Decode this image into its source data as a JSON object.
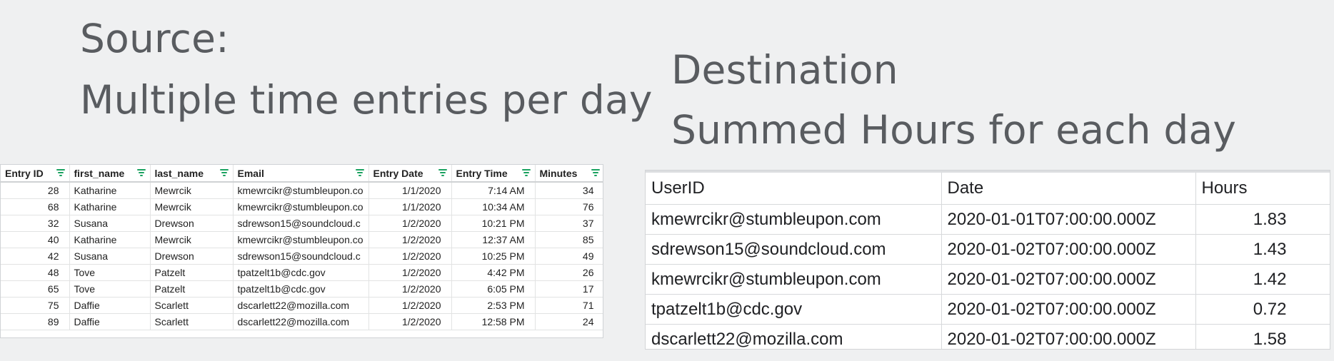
{
  "source": {
    "title": "Source:",
    "subtitle": "Multiple time entries per day",
    "columns": [
      "Entry ID",
      "first_name",
      "last_name",
      "Email",
      "Entry Date",
      "Entry Time",
      "Minutes"
    ],
    "filter_icon": "filter-icon",
    "filter_color": "#1aa260",
    "rows": [
      [
        "28",
        "Katharine",
        "Mewrcik",
        "kmewrcikr@stumbleupon.co",
        "1/1/2020",
        "7:14 AM",
        "34"
      ],
      [
        "68",
        "Katharine",
        "Mewrcik",
        "kmewrcikr@stumbleupon.co",
        "1/1/2020",
        "10:34 AM",
        "76"
      ],
      [
        "32",
        "Susana",
        "Drewson",
        "sdrewson15@soundcloud.c",
        "1/2/2020",
        "10:21 PM",
        "37"
      ],
      [
        "40",
        "Katharine",
        "Mewrcik",
        "kmewrcikr@stumbleupon.co",
        "1/2/2020",
        "12:37 AM",
        "85"
      ],
      [
        "42",
        "Susana",
        "Drewson",
        "sdrewson15@soundcloud.c",
        "1/2/2020",
        "10:25 PM",
        "49"
      ],
      [
        "48",
        "Tove",
        "Patzelt",
        "tpatzelt1b@cdc.gov",
        "1/2/2020",
        "4:42 PM",
        "26"
      ],
      [
        "65",
        "Tove",
        "Patzelt",
        "tpatzelt1b@cdc.gov",
        "1/2/2020",
        "6:05 PM",
        "17"
      ],
      [
        "75",
        "Daffie",
        "Scarlett",
        "dscarlett22@mozilla.com",
        "1/2/2020",
        "2:53 PM",
        "71"
      ],
      [
        "89",
        "Daffie",
        "Scarlett",
        "dscarlett22@mozilla.com",
        "1/2/2020",
        "12:58 PM",
        "24"
      ]
    ]
  },
  "destination": {
    "title": "Destination",
    "subtitle": "Summed Hours for each day",
    "columns": [
      "UserID",
      "Date",
      "Hours"
    ],
    "rows": [
      [
        "kmewrcikr@stumbleupon.com",
        "2020-01-01T07:00:00.000Z",
        "1.83"
      ],
      [
        "sdrewson15@soundcloud.com",
        "2020-01-02T07:00:00.000Z",
        "1.43"
      ],
      [
        "kmewrcikr@stumbleupon.com",
        "2020-01-02T07:00:00.000Z",
        "1.42"
      ],
      [
        "tpatzelt1b@cdc.gov",
        "2020-01-02T07:00:00.000Z",
        "0.72"
      ],
      [
        "dscarlett22@mozilla.com",
        "2020-01-02T07:00:00.000Z",
        "1.58"
      ]
    ]
  }
}
